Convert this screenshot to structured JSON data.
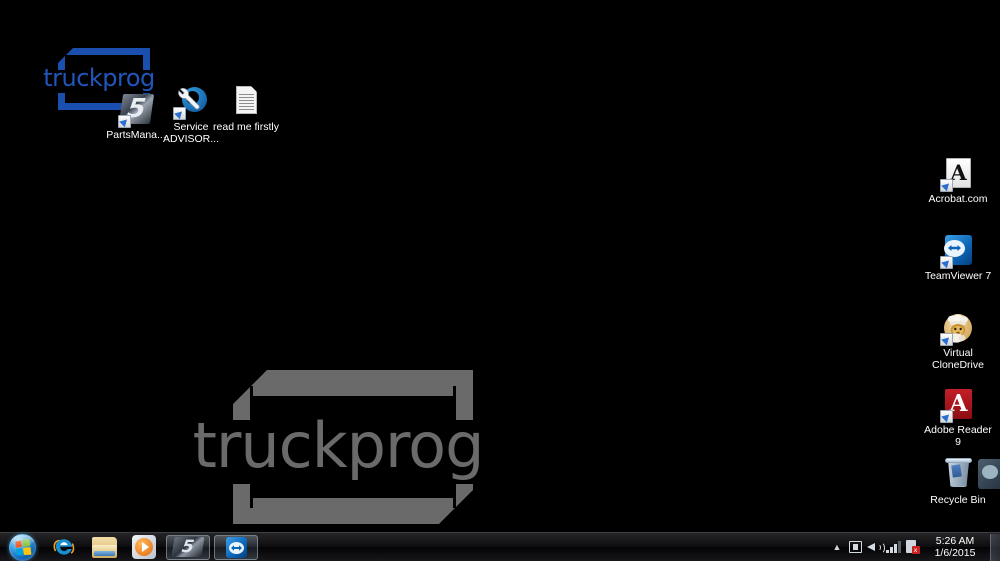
{
  "desktop": {
    "background_color": "#000000",
    "watermark": {
      "text": "truckprog",
      "color": "#6a6a6a"
    },
    "brand_logo": {
      "text": "truckprog",
      "color": "#1a4fb0"
    },
    "icons_left": [
      {
        "id": "partsmanager",
        "label": "PartsMana...",
        "icon": "parts-manager-five-icon",
        "shortcut": true
      },
      {
        "id": "service-advisor",
        "label": "Service ADVISOR...",
        "icon": "wrench-icon",
        "shortcut": true
      },
      {
        "id": "read-me-firstly",
        "label": "read me firstly",
        "icon": "text-document-icon",
        "shortcut": false
      }
    ],
    "icons_right": [
      {
        "id": "acrobat-com",
        "label": "Acrobat.com",
        "icon": "acrobat-page-icon",
        "shortcut": true
      },
      {
        "id": "teamviewer-7",
        "label": "TeamViewer 7",
        "icon": "teamviewer-icon",
        "shortcut": true
      },
      {
        "id": "virtual-clonedrive",
        "label": "Virtual CloneDrive",
        "icon": "sheep-chef-icon",
        "shortcut": true
      },
      {
        "id": "adobe-reader-9",
        "label": "Adobe Reader 9",
        "icon": "adobe-reader-icon",
        "shortcut": true
      },
      {
        "id": "recycle-bin",
        "label": "Recycle Bin",
        "icon": "recycle-bin-icon",
        "shortcut": false
      }
    ]
  },
  "taskbar": {
    "start_button": {
      "label": "Start",
      "icon": "windows-start-orb-icon"
    },
    "quick_launch": [
      {
        "id": "internet-explorer",
        "label": "Internet Explorer",
        "icon": "internet-explorer-icon"
      },
      {
        "id": "windows-explorer",
        "label": "Windows Explorer",
        "icon": "folder-icon"
      },
      {
        "id": "windows-media-player",
        "label": "Windows Media Player",
        "icon": "media-player-icon"
      }
    ],
    "running_tasks": [
      {
        "id": "parts-manager-window",
        "label": "PartsManager",
        "icon": "parts-manager-five-icon"
      },
      {
        "id": "teamviewer-window",
        "label": "TeamViewer",
        "icon": "teamviewer-icon"
      }
    ],
    "tray": {
      "show_hidden_label": "Show hidden icons",
      "icons": [
        {
          "id": "action-center",
          "label": "Action Center",
          "icon": "action-center-icon"
        },
        {
          "id": "volume",
          "label": "Volume",
          "icon": "speaker-icon"
        },
        {
          "id": "network",
          "label": "Network",
          "icon": "network-signal-icon"
        },
        {
          "id": "antivirus",
          "label": "Antivirus",
          "icon": "antivirus-icon",
          "badge": "x"
        }
      ]
    },
    "clock": {
      "time": "5:26 AM",
      "date": "1/6/2015"
    },
    "show_desktop_label": "Show desktop"
  }
}
